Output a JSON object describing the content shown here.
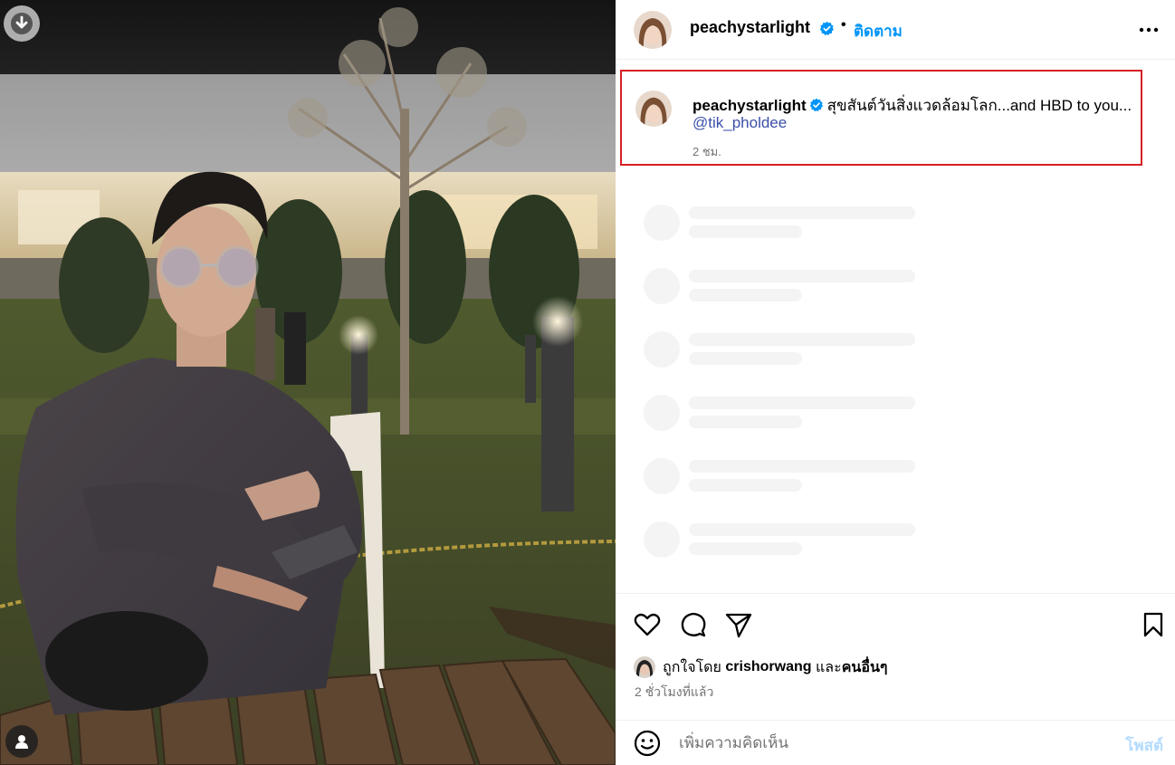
{
  "post": {
    "author": "peachystarlight",
    "follow_label": "ติดตาม",
    "dot": "•",
    "caption_text": "สุขสันต์วันสิ่งแวดล้อมโลก...and HBD to you...",
    "caption_mention": "@tik_pholdee",
    "caption_time": "2 ชม.",
    "liked_by_prefix": "ถูกใจโดย",
    "liked_by_user": "crishorwang",
    "liked_by_and": "และ",
    "liked_by_others": "คนอื่นๆ",
    "post_time": "2 ชั่วโมงที่แล้ว"
  },
  "comment": {
    "placeholder": "เพิ่มความคิดเห็น",
    "post_label": "โพสต์"
  },
  "icons": {
    "download": "arrow-down-icon",
    "user_tag": "user-icon",
    "verified": "verified-badge-icon",
    "more": "more-horizontal-icon",
    "like": "heart-icon",
    "comment": "comment-bubble-icon",
    "share": "paper-plane-icon",
    "save": "bookmark-icon",
    "emoji": "emoji-icon"
  },
  "colors": {
    "accent": "#0095f6",
    "verified": "#0095f6",
    "highlight_border": "#d61f26",
    "mention": "#3b4fa8",
    "secondary_text": "#737373",
    "post_disabled": "#b3dbff"
  }
}
